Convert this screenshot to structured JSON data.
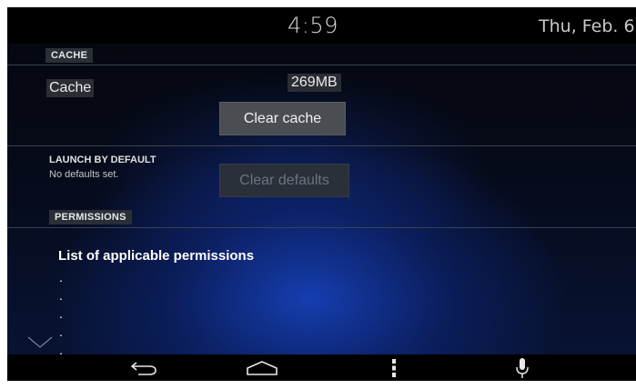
{
  "status_bar": {
    "time": "4:59",
    "date": "Thu, Feb. 6"
  },
  "cache_section": {
    "header": "CACHE",
    "label": "Cache",
    "value": "269MB",
    "clear_button": "Clear cache"
  },
  "launch_section": {
    "header": "LAUNCH BY DEFAULT",
    "status": "No defaults set.",
    "clear_button": "Clear defaults"
  },
  "permissions_section": {
    "header": "PERMISSIONS",
    "title": "List of applicable  permissions",
    "items": [
      ".",
      ".",
      ".",
      ".",
      "."
    ]
  },
  "icons": {
    "scroll": "chevron-down-icon",
    "back": "back-icon",
    "home": "home-icon",
    "menu": "menu-icon",
    "voice": "microphone-icon"
  },
  "colors": {
    "background": "#060a18",
    "accent_glow": "#1846c8",
    "button_bg": "#4a4d52"
  }
}
